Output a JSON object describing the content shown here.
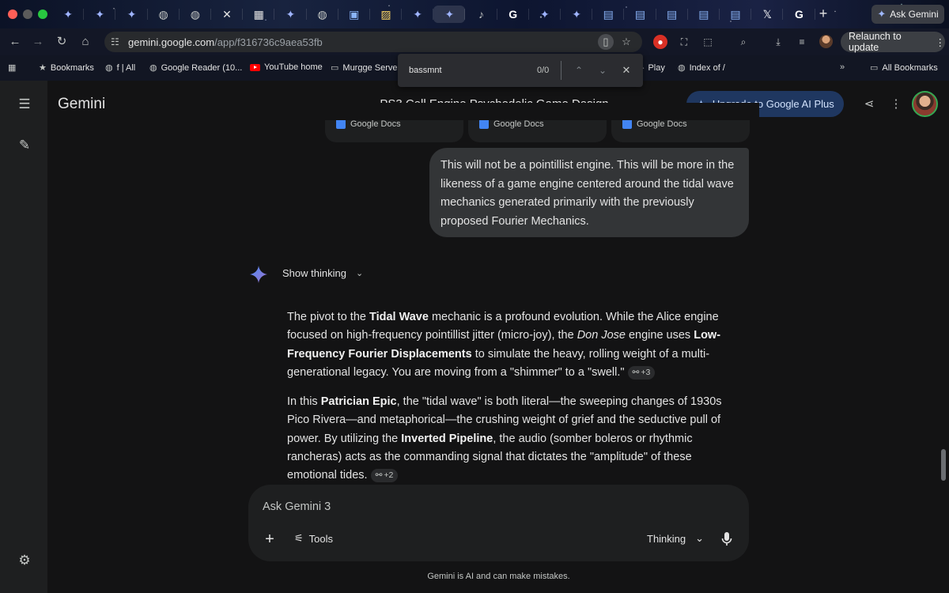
{
  "browser": {
    "tabs_count_visible": 24,
    "ask_gemini_label": "Ask Gemini",
    "url_host": "gemini.google.com",
    "url_path": "/app/f316736c9aea53fb",
    "relaunch_label": "Relaunch to update",
    "bookmarks": [
      {
        "label": "Bookmarks",
        "icon": "star-icon"
      },
      {
        "label": "f | All",
        "icon": "globe-icon"
      },
      {
        "label": "Google Reader (10...",
        "icon": "globe-icon"
      },
      {
        "label": "YouTube home",
        "icon": "youtube-icon"
      },
      {
        "label": "Murgge Serve",
        "icon": "folder-icon"
      },
      {
        "label": "Play",
        "icon": "play-icon"
      },
      {
        "label": "Index of /",
        "icon": "globe-icon"
      }
    ],
    "all_bookmarks_label": "All Bookmarks"
  },
  "findbar": {
    "query": "bassmnt",
    "count": "0/0"
  },
  "app": {
    "brand": "Gemini",
    "conversation_title": "PS3 Cell Engine Psychedelic Game Design",
    "upgrade_label": "Upgrade to Google AI Plus",
    "doc_chip_label": "Google Docs",
    "user_message": "This will not be a pointillist engine. This will be more in the likeness of a game engine centered around the tidal wave mechanics generated primarily with the previously proposed Fourier Mechanics.",
    "show_thinking_label": "Show thinking",
    "response": {
      "p1": {
        "t1": "The pivot to the ",
        "b1": "Tidal Wave",
        "t2": " mechanic is a profound evolution. While the Alice engine focused on high-frequency pointillist jitter (micro-joy), the ",
        "i1": "Don Jose",
        "t3": " engine uses ",
        "b2": "Low-Frequency Fourier Displacements",
        "t4": " to simulate the heavy, rolling weight of a multi-generational legacy. You are moving from a \"shimmer\" to a \"swell.\"",
        "cite": "+3"
      },
      "p2": {
        "t1": "In this ",
        "b1": "Patrician Epic",
        "t2": ", the \"tidal wave\" is both literal—the sweeping changes of 1930s Pico Rivera—and metaphorical—the crushing weight of grief and the seductive pull of power. By utilizing the ",
        "b2": "Inverted Pipeline",
        "t3": ", the audio (somber boleros or rhythmic rancheras) acts as the commanding signal that dictates the \"amplitude\" of these emotional tides.",
        "cite": "+2"
      }
    },
    "composer": {
      "placeholder": "Ask Gemini 3",
      "tools_label": "Tools",
      "mode_label": "Thinking"
    },
    "disclaimer": "Gemini is AI and can make mistakes."
  },
  "colors": {
    "background": "#131314",
    "sidebar": "#1e1f20",
    "user_bubble": "#333537",
    "upgrade_button": "#1f3760",
    "accent_blue": "#4285f4"
  }
}
